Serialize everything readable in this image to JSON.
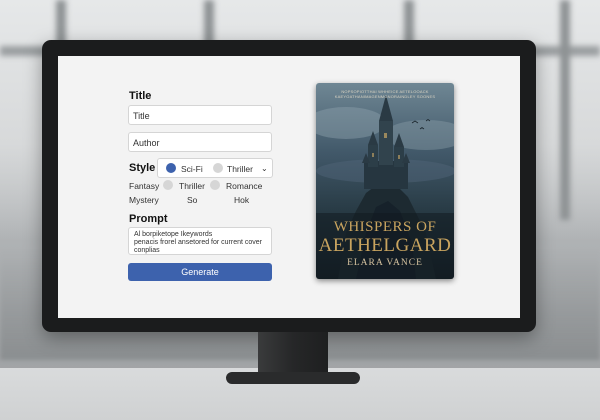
{
  "form": {
    "title_label": "Title",
    "title_value": "Title",
    "author_value": "Author",
    "style_label": "Style",
    "style_select": {
      "option_selected": "Sci-Fi",
      "option_other": "Thriller"
    },
    "genres": {
      "row1": [
        "Fantasy",
        "Thriller",
        "Romance"
      ],
      "row2": [
        "Mystery",
        "So",
        "Hok"
      ]
    },
    "prompt_label": "Prompt",
    "prompt_line1": "Al borpiketope  Ikeywords",
    "prompt_line2": "penacis frorel ansetored for current cover",
    "prompt_line3": "conplias",
    "generate_label": "Generate"
  },
  "cover": {
    "tagline": "NOPSOPIOTTHAI WHHEICE AETELOOACK KAEYOATHANIMAGENMGNORAINDLEY SOONES",
    "title_line1": "WHISPERS OF",
    "title_line2": "AETHELGARD",
    "author": "ELARA VANCE",
    "colors": {
      "accent_gold": "#c9a45f",
      "sky_dark": "#24363f"
    }
  },
  "colors": {
    "primary_button": "#3d62ad",
    "monitor_bezel": "#1b1c1d"
  }
}
